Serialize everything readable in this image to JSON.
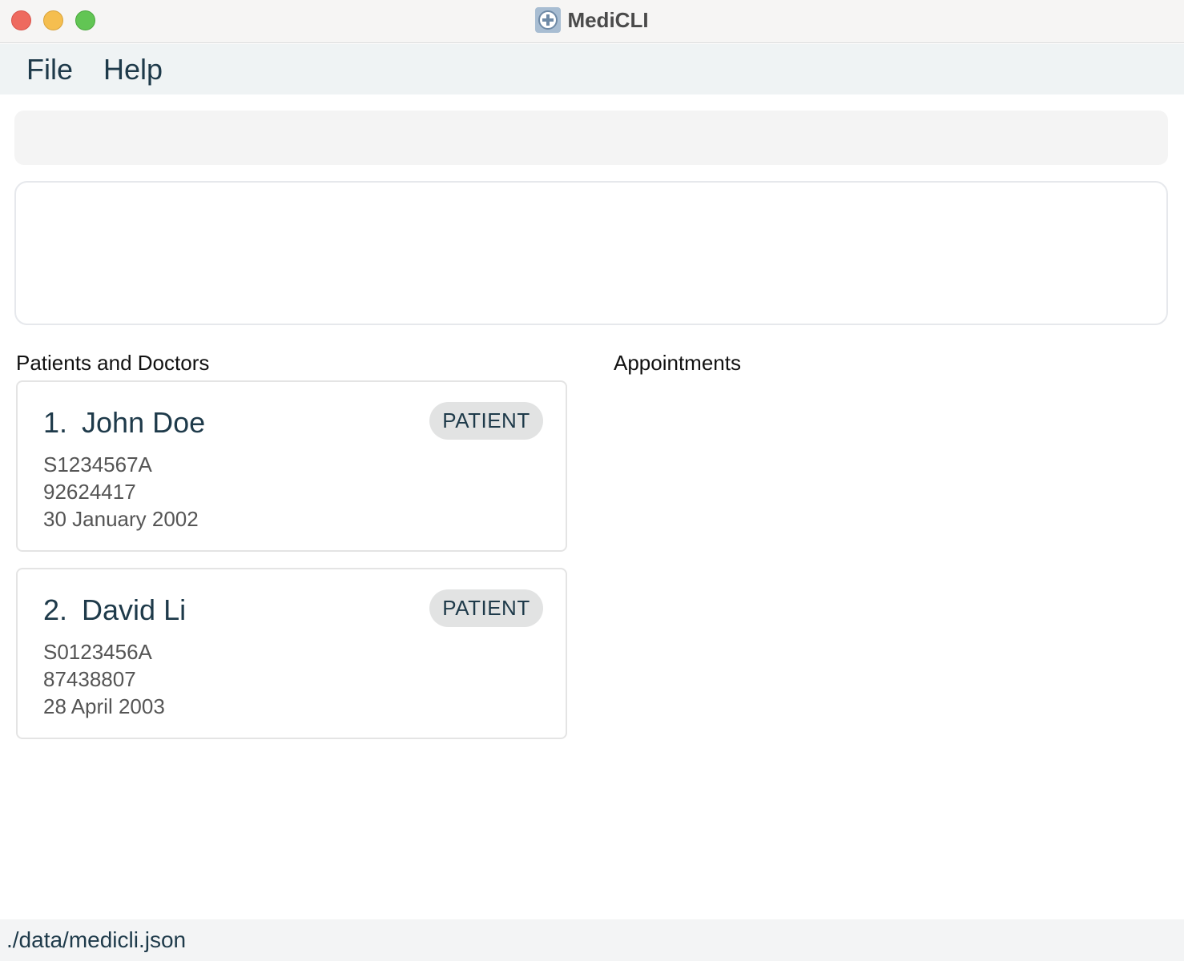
{
  "window": {
    "title": "MediCLI"
  },
  "menubar": {
    "items": [
      {
        "label": "File"
      },
      {
        "label": "Help"
      }
    ]
  },
  "command": {
    "value": "",
    "placeholder": ""
  },
  "result": {
    "text": ""
  },
  "sections": {
    "left_title": "Patients and Doctors",
    "right_title": "Appointments"
  },
  "persons": [
    {
      "index": "1.",
      "name": "John Doe",
      "role": "PATIENT",
      "nric": "S1234567A",
      "phone": "92624417",
      "dob": "30 January 2002"
    },
    {
      "index": "2.",
      "name": "David Li",
      "role": "PATIENT",
      "nric": "S0123456A",
      "phone": "87438807",
      "dob": "28 April 2003"
    }
  ],
  "status": {
    "file_path": "./data/medicli.json"
  },
  "colors": {
    "accent": "#1e3a4a",
    "badge_bg": "#e2e3e3",
    "close": "#ee6a5f",
    "minimize": "#f5be4f",
    "maximize": "#62c554"
  }
}
